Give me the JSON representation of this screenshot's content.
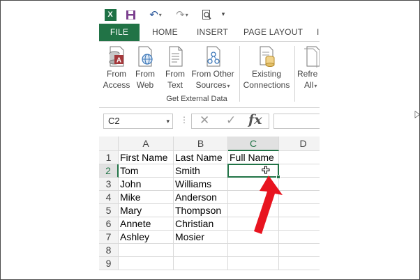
{
  "quick_access": {
    "app_icon_letter": "X",
    "save_icon": "floppy-disk-icon",
    "undo_icon": "↶",
    "redo_icon": "↷",
    "print_preview_icon": "magnifier-page-icon",
    "customize_icon": "▾"
  },
  "ribbon_tabs": [
    {
      "label": "FILE",
      "active": true
    },
    {
      "label": "HOME"
    },
    {
      "label": "INSERT"
    },
    {
      "label": "PAGE LAYOUT"
    },
    {
      "label": "I"
    }
  ],
  "ribbon": {
    "group_label": "Get External Data",
    "buttons": [
      {
        "line1": "From",
        "line2": "Access",
        "icon": "access-database-icon"
      },
      {
        "line1": "From",
        "line2": "Web",
        "icon": "globe-page-icon"
      },
      {
        "line1": "From",
        "line2": "Text",
        "icon": "text-file-icon"
      },
      {
        "line1": "From Other",
        "line2": "Sources",
        "icon": "other-sources-icon"
      },
      {
        "line1": "Existing",
        "line2": "Connections",
        "icon": "connections-icon"
      },
      {
        "line1": "Refre",
        "line2": "All",
        "icon": "refresh-icon"
      }
    ]
  },
  "formula_bar": {
    "name_box": "C2",
    "cancel_glyph": "✕",
    "enter_glyph": "✓",
    "fx_label": "fx",
    "formula_value": ""
  },
  "grid": {
    "columns": [
      "A",
      "B",
      "C",
      "D"
    ],
    "selected_column": "C",
    "rows": [
      "1",
      "2",
      "3",
      "4",
      "5",
      "6",
      "7",
      "8",
      "9"
    ],
    "selected_row": "2",
    "cells": {
      "A1": "First Name",
      "B1": "Last Name",
      "C1": "Full Name",
      "A2": "Tom",
      "B2": "Smith",
      "A3": "John",
      "B3": "Williams",
      "A4": "Mike",
      "B4": "Anderson",
      "A5": "Mary",
      "B5": "Thompson",
      "A6": "Annete",
      "B6": "Christian",
      "A7": "Ashley",
      "B7": "Mosier"
    },
    "active_cell": "C2"
  },
  "colors": {
    "excel_green": "#217346",
    "annotation_red": "#e8141f"
  }
}
